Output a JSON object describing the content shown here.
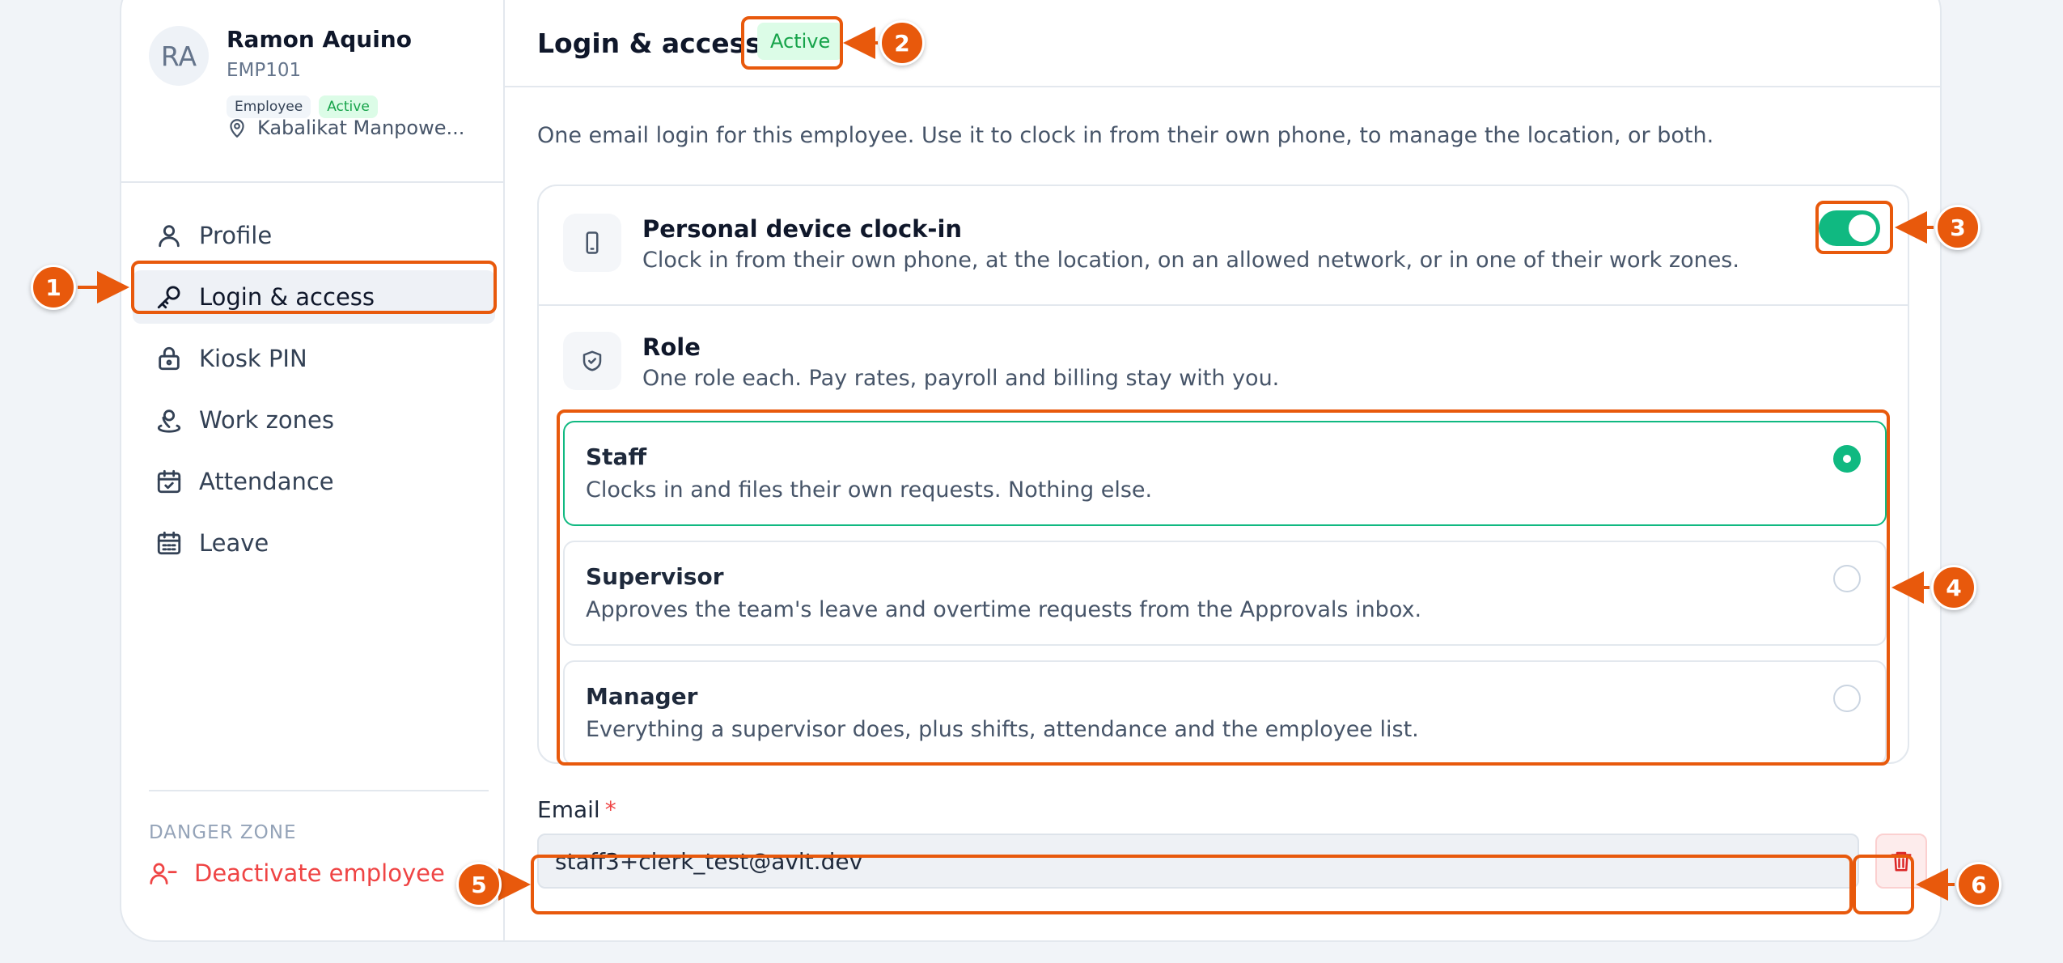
{
  "employee": {
    "initials": "RA",
    "name": "Ramon Aquino",
    "id": "EMP101",
    "role_badge": "Employee",
    "status_badge": "Active",
    "location": "Kabalikat Manpowe..."
  },
  "nav": {
    "items": [
      {
        "label": "Profile",
        "icon": "user-icon"
      },
      {
        "label": "Login & access",
        "icon": "key-icon",
        "active": true
      },
      {
        "label": "Kiosk PIN",
        "icon": "lock-icon"
      },
      {
        "label": "Work zones",
        "icon": "map-pin-user-icon"
      },
      {
        "label": "Attendance",
        "icon": "calendar-check-icon"
      },
      {
        "label": "Leave",
        "icon": "calendar-icon"
      }
    ]
  },
  "danger_zone": {
    "title": "DANGER ZONE",
    "deactivate_label": "Deactivate employee"
  },
  "main": {
    "title": "Login & access",
    "status": "Active",
    "intro": "One email login for this employee. Use it to clock in from their own phone, to manage the location, or both.",
    "device_clockin": {
      "title": "Personal device clock-in",
      "description": "Clock in from their own phone, at the location, on an allowed network, or in one of their work zones.",
      "enabled": true
    },
    "role": {
      "title": "Role",
      "description": "One role each. Pay rates, payroll and billing stay with you.",
      "selected": "Staff",
      "options": [
        {
          "title": "Staff",
          "description": "Clocks in and files their own requests. Nothing else."
        },
        {
          "title": "Supervisor",
          "description": "Approves the team's leave and overtime requests from the Approvals inbox."
        },
        {
          "title": "Manager",
          "description": "Everything a supervisor does, plus shifts, attendance and the employee list."
        }
      ]
    },
    "email": {
      "label": "Email",
      "required_mark": "*",
      "value": "staff3+clerk_test@avit.dev"
    }
  },
  "annotations": [
    "1",
    "2",
    "3",
    "4",
    "5",
    "6"
  ],
  "colors": {
    "accent": "#10b981",
    "annotation": "#e8590c",
    "danger": "#ef4444"
  }
}
